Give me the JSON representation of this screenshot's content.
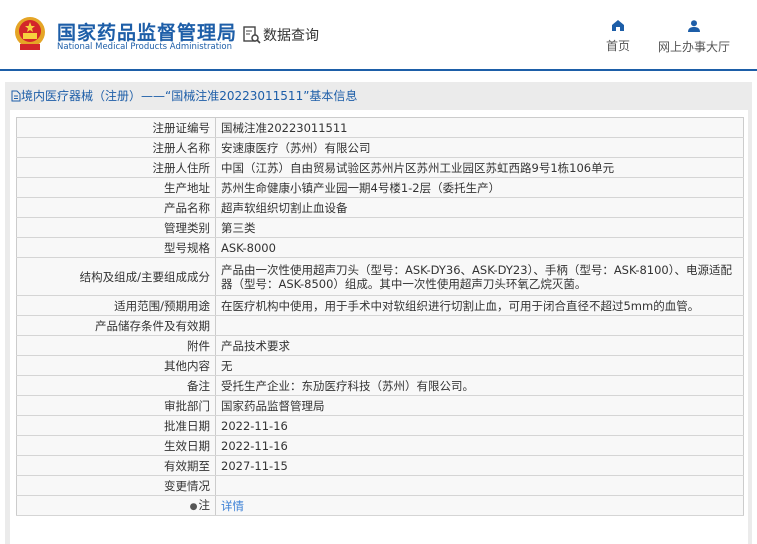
{
  "header": {
    "title": "国家药品监督管理局",
    "subtitle": "National Medical Products Administration",
    "data_query": "数据查询",
    "nav": [
      {
        "label": "首页",
        "icon": "home-icon"
      },
      {
        "label": "网上办事大厅",
        "icon": "user-icon"
      }
    ]
  },
  "panel": {
    "title": "境内医疗器械（注册）——“国械注准20223011511”基本信息"
  },
  "rows": [
    {
      "label": "注册证编号",
      "value": "国械注准20223011511"
    },
    {
      "label": "注册人名称",
      "value": "安速康医疗（苏州）有限公司"
    },
    {
      "label": "注册人住所",
      "value": "中国（江苏）自由贸易试验区苏州片区苏州工业园区苏虹西路9号1栋106单元"
    },
    {
      "label": "生产地址",
      "value": "苏州生命健康小镇产业园一期4号楼1-2层（委托生产）"
    },
    {
      "label": "产品名称",
      "value": "超声软组织切割止血设备"
    },
    {
      "label": "管理类别",
      "value": "第三类"
    },
    {
      "label": "型号规格",
      "value": "ASK-8000"
    },
    {
      "label": "结构及组成/主要组成成分",
      "value": "产品由一次性使用超声刀头（型号：ASK-DY36、ASK-DY23）、手柄（型号：ASK-8100）、电源适配器（型号：ASK-8500）组成。其中一次性使用超声刀头环氧乙烷灭菌。"
    },
    {
      "label": "适用范围/预期用途",
      "value": "在医疗机构中使用，用于手术中对软组织进行切割止血，可用于闭合直径不超过5mm的血管。"
    },
    {
      "label": "产品储存条件及有效期",
      "value": ""
    },
    {
      "label": "附件",
      "value": "产品技术要求"
    },
    {
      "label": "其他内容",
      "value": "无"
    },
    {
      "label": "备注",
      "value": "受托生产企业：东劢医疗科技（苏州）有限公司。"
    },
    {
      "label": "审批部门",
      "value": "国家药品监督管理局"
    },
    {
      "label": "批准日期",
      "value": "2022-11-16"
    },
    {
      "label": "生效日期",
      "value": "2022-11-16"
    },
    {
      "label": "有效期至",
      "value": "2027-11-15"
    },
    {
      "label": "变更情况",
      "value": ""
    },
    {
      "label": "注",
      "value": "详情"
    }
  ]
}
